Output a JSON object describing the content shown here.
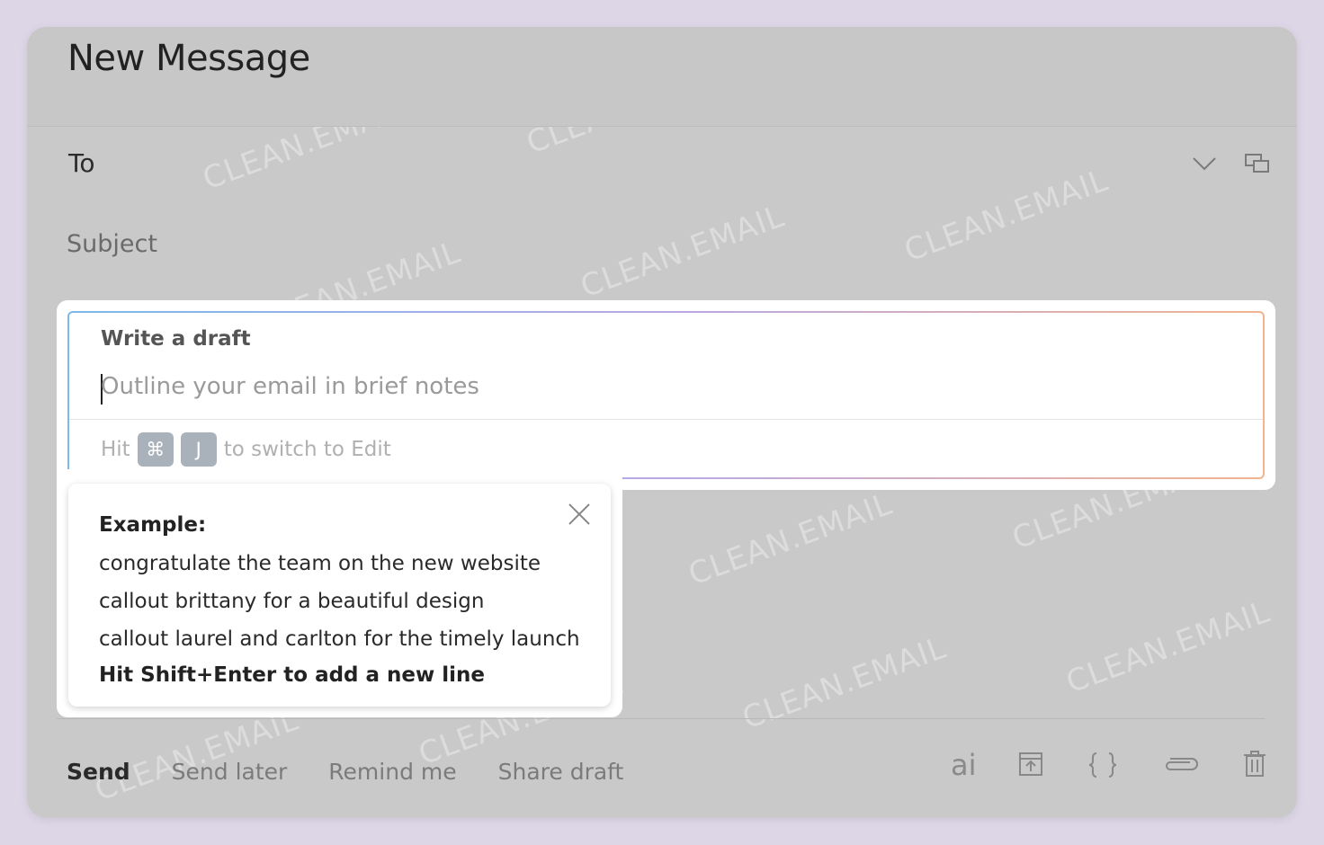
{
  "header": {
    "title": "New Message"
  },
  "to_field": {
    "label": "To"
  },
  "subject_field": {
    "placeholder": "Subject"
  },
  "draft": {
    "label": "Write a draft",
    "placeholder": "Outline your email in brief notes",
    "hint_prefix": "Hit",
    "key_cmd": "⌘",
    "key_j": "J",
    "hint_suffix": "to switch to Edit"
  },
  "example_popup": {
    "title": "Example:",
    "lines": [
      "congratulate the team on the new website",
      "callout brittany for a beautiful design",
      "callout laurel and carlton for the timely launch"
    ],
    "hint": "Hit Shift+Enter to add a new line"
  },
  "actions": {
    "send": "Send",
    "send_later": "Send later",
    "remind_me": "Remind me",
    "share_draft": "Share draft"
  },
  "toolbar": {
    "ai_label": "ai",
    "icons": [
      "ai-icon",
      "upload-icon",
      "code-braces-icon",
      "paperclip-icon",
      "trash-icon"
    ]
  },
  "colors": {
    "frame": "#dcd6e6",
    "window": "#c9c9c9",
    "draft_border_start": "#7ab9ea",
    "draft_border_end": "#f2b48f"
  },
  "watermark_text": "CLEAN.EMAIL"
}
